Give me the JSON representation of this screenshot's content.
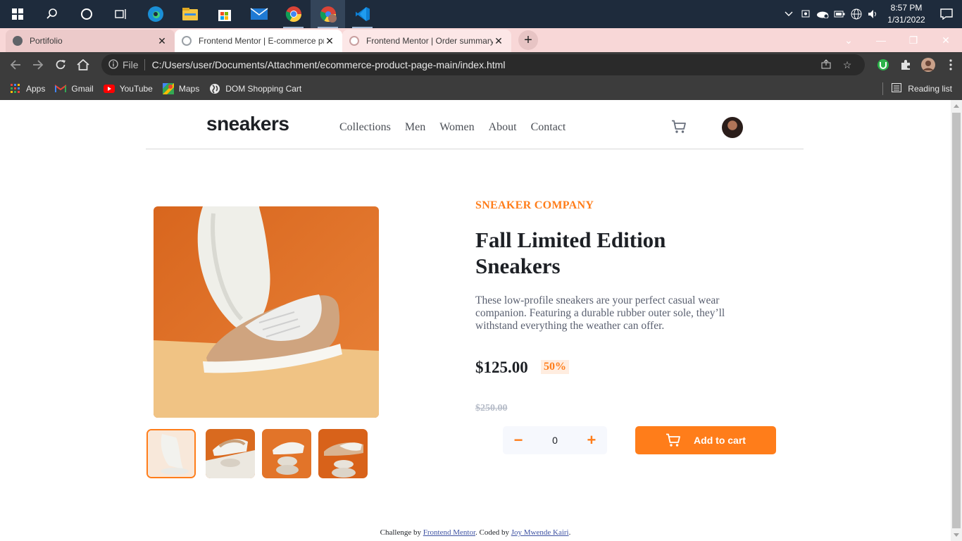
{
  "taskbar": {
    "time": "8:57 PM",
    "date": "1/31/2022",
    "apps": [
      "start-icon",
      "search-icon",
      "cortana-icon",
      "task-view-icon",
      "edge-icon",
      "file-explorer-icon",
      "store-icon",
      "mail-icon",
      "chrome-icon",
      "chrome-profile-icon",
      "vscode-icon"
    ]
  },
  "browser": {
    "tabs": [
      {
        "title": "Portifolio"
      },
      {
        "title": "Frontend Mentor | E-commerce product page"
      },
      {
        "title": "Frontend Mentor | Order summary card"
      }
    ],
    "address_scheme": "File",
    "url": "C:/Users/user/Documents/Attachment/ecommerce-product-page-main/index.html",
    "bookmarks": [
      "Apps",
      "Gmail",
      "YouTube",
      "Maps",
      "DOM Shopping Cart"
    ],
    "reading_list": "Reading list"
  },
  "site": {
    "logo": "sneakers",
    "nav": [
      "Collections",
      "Men",
      "Women",
      "About",
      "Contact"
    ]
  },
  "product": {
    "company": "SNEAKER COMPANY",
    "title": "Fall Limited Edition Sneakers",
    "description": "These low-profile sneakers are your perfect casual wear companion. Featuring a durable rubber outer sole, they’ll withstand everything the weather can offer.",
    "price": "$125.00",
    "discount": "50%",
    "original_price": "$250.00",
    "quantity": "0",
    "add_to_cart": "Add to cart"
  },
  "footer": {
    "prefix": "Challenge by",
    "link1": "Frontend Mentor",
    "middle": ". Coded by",
    "link2": "Joy Mwende Kairi",
    "suffix": "."
  },
  "colors": {
    "accent": "#ff7d1a",
    "taskbar": "#1e2b3c",
    "tabstrip": "#f8d7d7"
  }
}
